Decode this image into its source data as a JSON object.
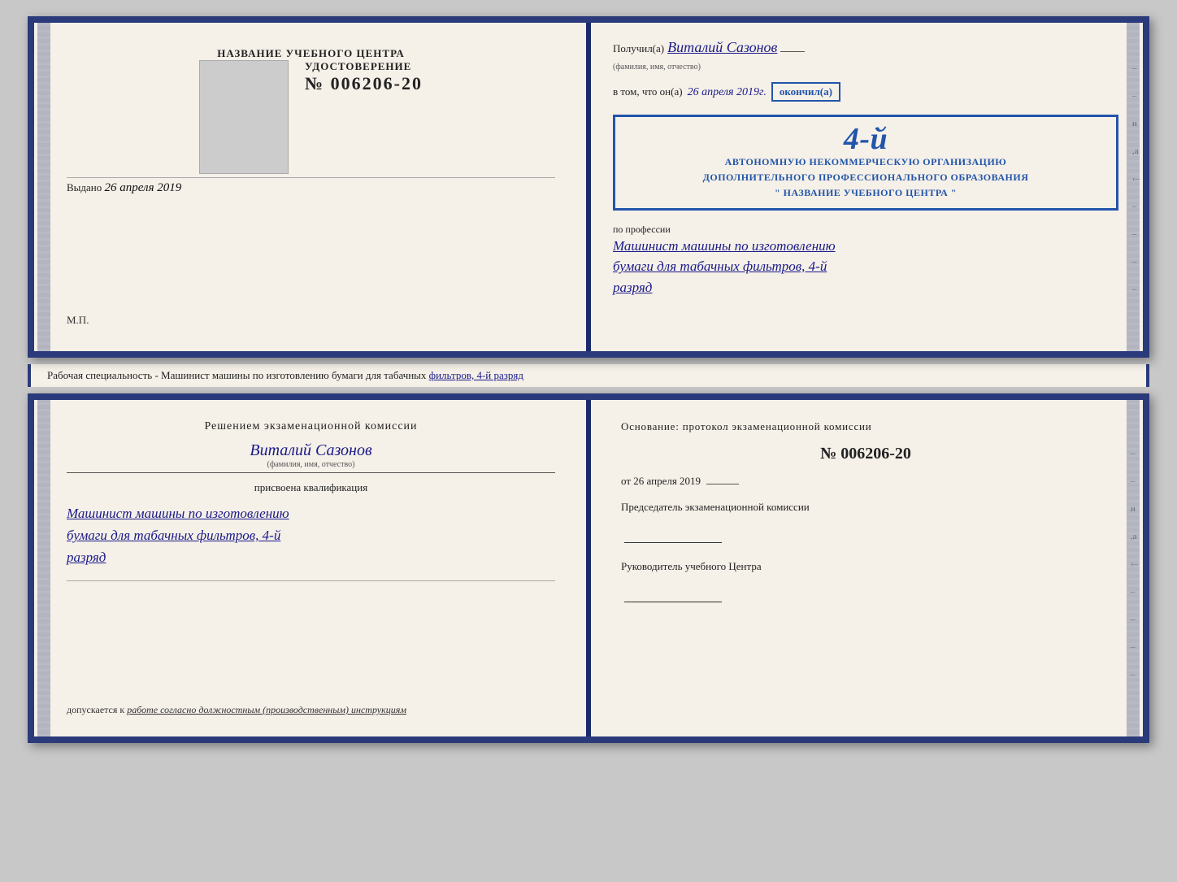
{
  "top_cert": {
    "left": {
      "title": "НАЗВАНИЕ УЧЕБНОГО ЦЕНТРА",
      "doc_label": "УДОСТОВЕРЕНИЕ",
      "doc_number": "№ 006206-20",
      "issued_label": "Выдано",
      "issued_date": "26 апреля 2019",
      "mp_label": "М.П."
    },
    "right": {
      "poluchil_prefix": "Получил(а)",
      "recipient_name": "Виталий Сазонов",
      "fio_caption": "(фамилия, имя, отчество)",
      "vtom_prefix": "в том, что он(а)",
      "vtom_date": "26 апреля 2019г.",
      "okanchil": "окончил(а)",
      "stamp_line1": "АВТОНОМНУЮ НЕКОММЕРЧЕСКУЮ ОРГАНИЗАЦИЮ",
      "stamp_line2": "ДОПОЛНИТЕЛЬНОГО ПРОФЕССИОНАЛЬНОГО ОБРАЗОВАНИЯ",
      "stamp_line3": "\" НАЗВАНИЕ УЧЕБНОГО ЦЕНТРА \"",
      "stamp_big": "4-й",
      "po_professii": "по профессии",
      "prof_line1": "Машинист машины по изготовлению",
      "prof_line2": "бумаги для табачных фильтров, 4-й",
      "prof_line3": "разряд"
    }
  },
  "middle_strip": {
    "text_prefix": "Рабочая специальность - Машинист машины по изготовлению бумаги для табачных",
    "text_underlined": "фильтров, 4-й разряд"
  },
  "bottom_cert": {
    "left": {
      "komissia_title": "Решением  экзаменационной  комиссии",
      "person_name": "Виталий Сазонов",
      "fio_caption": "(фамилия, имя, отчество)",
      "prisvoena": "присвоена квалификация",
      "qual_line1": "Машинист машины по изготовлению",
      "qual_line2": "бумаги для табачных фильтров, 4-й",
      "qual_line3": "разряд",
      "dopuskaetsya_label": "допускается к",
      "dopuskaetsya_text": "работе согласно должностным (производственным) инструкциям"
    },
    "right": {
      "osnov_title": "Основание: протокол экзаменационной  комиссии",
      "protocol_number": "№  006206-20",
      "date_label": "от",
      "date_value": "26 апреля 2019",
      "predsedatel_label": "Председатель экзаменационной комиссии",
      "rukovoditel_label": "Руководитель учебного Центра"
    }
  }
}
